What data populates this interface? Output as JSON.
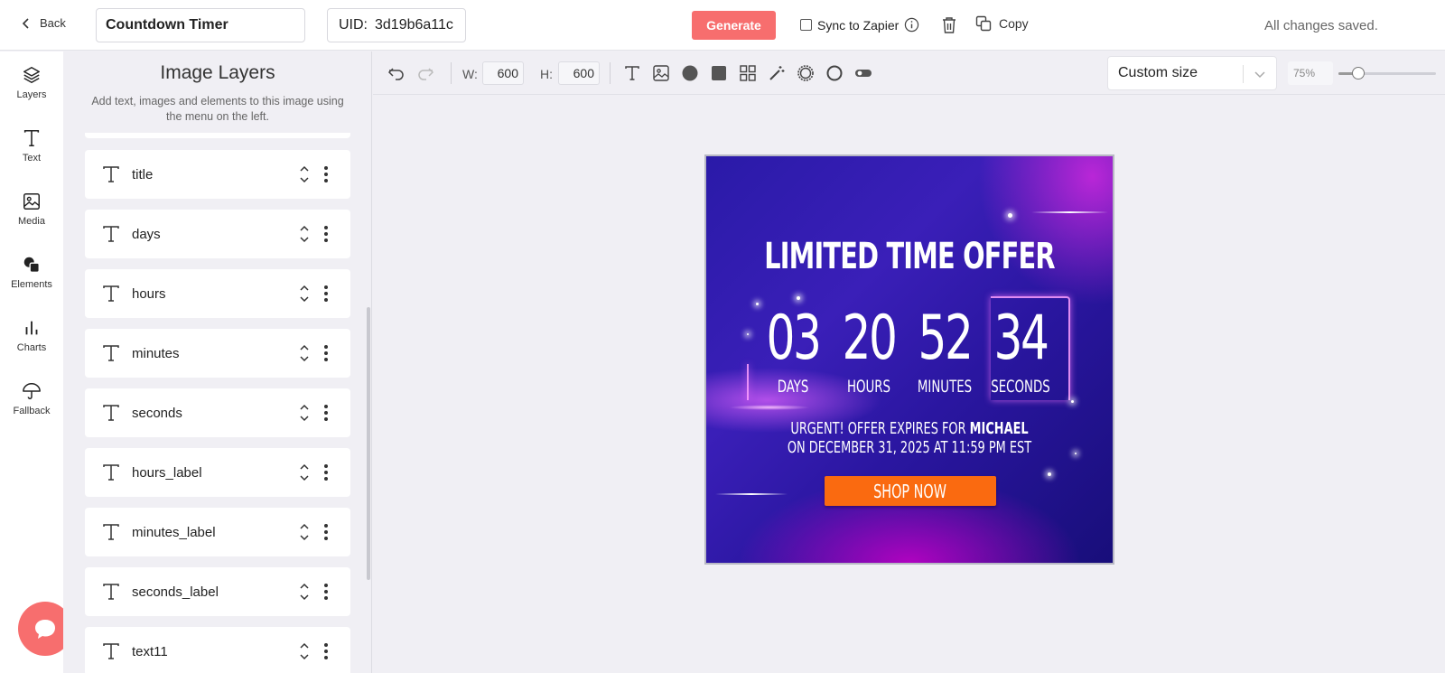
{
  "topbar": {
    "back_label": "Back",
    "doc_title": "Countdown Timer",
    "uid_label": "UID:",
    "uid_value": "3d19b6a11c",
    "generate_label": "Generate",
    "sync_label": "Sync to Zapier",
    "copy_label": "Copy",
    "status": "All changes saved."
  },
  "rail": {
    "items": [
      {
        "label": "Layers",
        "icon": "layers-icon"
      },
      {
        "label": "Text",
        "icon": "text-icon"
      },
      {
        "label": "Media",
        "icon": "image-icon"
      },
      {
        "label": "Elements",
        "icon": "shapes-icon"
      },
      {
        "label": "Charts",
        "icon": "bar-chart-icon"
      },
      {
        "label": "Fallback",
        "icon": "umbrella-icon"
      }
    ]
  },
  "panel": {
    "title": "Image Layers",
    "subtitle": "Add text, images and elements to this image using the menu on the left.",
    "layers": [
      "title",
      "days",
      "hours",
      "minutes",
      "seconds",
      "hours_label",
      "minutes_label",
      "seconds_label",
      "text11"
    ]
  },
  "toolbar": {
    "width_label": "W:",
    "width_value": "600",
    "height_label": "H:",
    "height_value": "600",
    "size_preset": "Custom size",
    "zoom": "75%",
    "zoom_fraction": 0.2
  },
  "canvas": {
    "title": "LIMITED TIME OFFER",
    "countdown": [
      {
        "value": "03",
        "label": "DAYS"
      },
      {
        "value": "20",
        "label": "HOURS"
      },
      {
        "value": "52",
        "label": "MINUTES"
      },
      {
        "value": "34",
        "label": "SECONDS"
      }
    ],
    "urgent_prefix": "URGENT! OFFER EXPIRES FOR ",
    "urgent_name": "MICHAEL",
    "expiry_line": "ON DECEMBER 31, 2025 AT 11:59 PM EST",
    "cta_label": "SHOP NOW"
  },
  "colors": {
    "accent": "#f76e6e",
    "cta": "#fa6a10"
  }
}
